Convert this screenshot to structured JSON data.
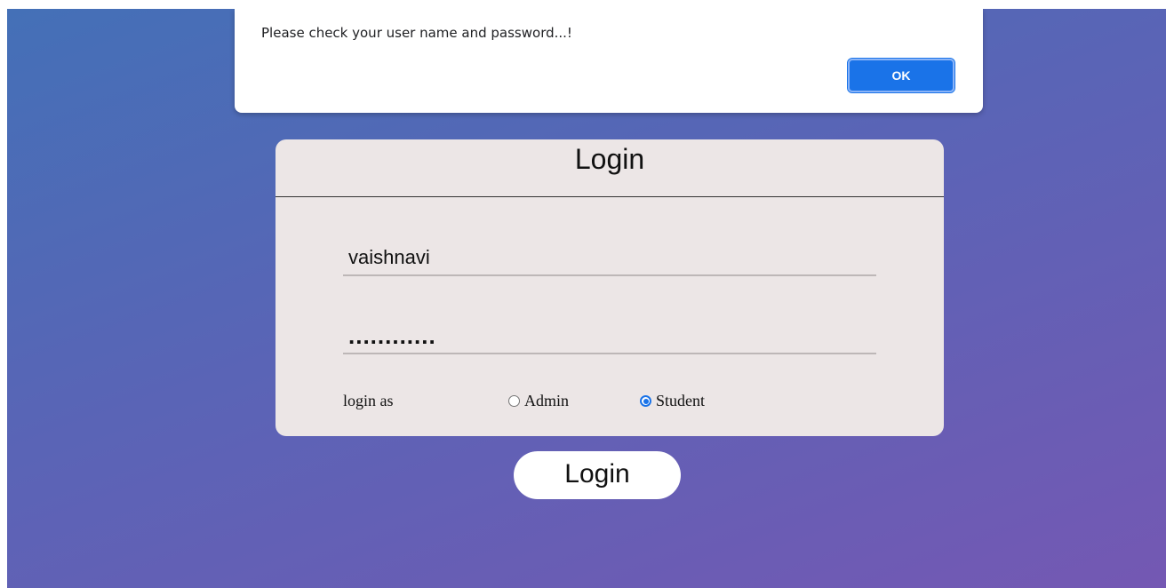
{
  "alert": {
    "message": "Please check your user name and password...!",
    "ok_label": "OK"
  },
  "login_card": {
    "title": "Login",
    "username_value": "vaishnavi",
    "password_value": "............",
    "login_as_label": "login as",
    "roles": [
      {
        "label": "Admin",
        "selected": false
      },
      {
        "label": "Student",
        "selected": true
      }
    ]
  },
  "login_button_label": "Login",
  "colors": {
    "gradient_start": "#4470b7",
    "gradient_end": "#7458b3",
    "card_bg": "#ece6e6",
    "accent": "#1a73e8"
  }
}
